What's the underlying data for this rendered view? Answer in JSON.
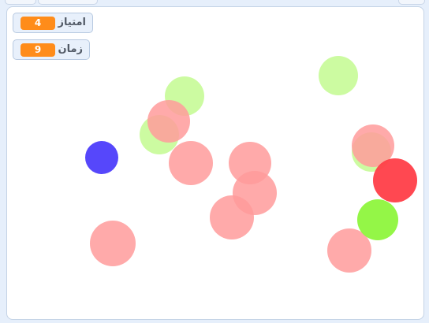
{
  "colors": {
    "stage_background": "#ffffff",
    "monitor_value_background": "#ff8c1a",
    "pale_red": "#ff9b9b",
    "pale_green": "#c6fb97",
    "blue": "#4d3dfb",
    "red": "#ff3e48",
    "green": "#8ef53d"
  },
  "monitors": [
    {
      "label": "امتیاز",
      "value": "4"
    },
    {
      "label": "زمان",
      "value": "9"
    }
  ],
  "sprites": [
    {
      "kind": "balloon",
      "color_role": "pale_green",
      "opacity": 0.9
    },
    {
      "kind": "balloon",
      "color_role": "pale_green",
      "opacity": 0.9
    },
    {
      "kind": "balloon",
      "color_role": "pale_green",
      "opacity": 0.9
    },
    {
      "kind": "balloon",
      "color_role": "pale_green",
      "opacity": 0.9
    },
    {
      "kind": "balloon",
      "color_role": "pale_red",
      "opacity": 0.85
    },
    {
      "kind": "balloon",
      "color_role": "pale_red",
      "opacity": 0.85
    },
    {
      "kind": "balloon",
      "color_role": "pale_red",
      "opacity": 0.85
    },
    {
      "kind": "balloon",
      "color_role": "pale_red",
      "opacity": 0.85
    },
    {
      "kind": "balloon",
      "color_role": "pale_red",
      "opacity": 0.85
    },
    {
      "kind": "balloon",
      "color_role": "pale_red",
      "opacity": 0.85
    },
    {
      "kind": "balloon",
      "color_role": "pale_red",
      "opacity": 0.85
    },
    {
      "kind": "balloon",
      "color_role": "pale_red",
      "opacity": 0.85
    },
    {
      "kind": "balloon",
      "color_role": "blue",
      "opacity": 0.95
    },
    {
      "kind": "balloon",
      "color_role": "red",
      "opacity": 0.95
    },
    {
      "kind": "balloon",
      "color_role": "green",
      "opacity": 0.95
    }
  ]
}
